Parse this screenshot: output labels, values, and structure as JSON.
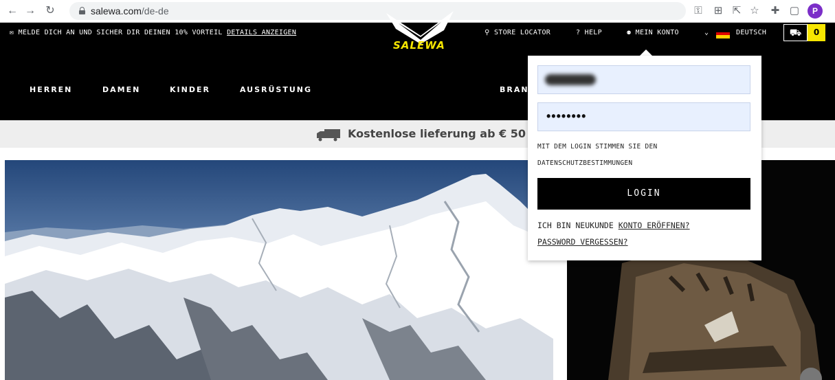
{
  "browser": {
    "back_icon": "arrow-left-icon",
    "forward_icon": "arrow-right-icon",
    "reload_icon": "reload-icon",
    "url_host": "salewa.com",
    "url_path": "/de-de",
    "profile_initial": "P"
  },
  "topbar": {
    "promo_text": "MELDE DICH AN UND SICHER DIR DEINEN 10% VORTEIL",
    "promo_link": "DETAILS ANZEIGEN",
    "store_locator": "STORE LOCATOR",
    "help": "HELP",
    "account": "MEIN KONTO",
    "language": "DEUTSCH",
    "cart_count": "0"
  },
  "nav": {
    "items": [
      "HERREN",
      "DAMEN",
      "KINDER",
      "AUSRÜSTUNG"
    ],
    "brand_partial": "BRAN",
    "logo_text": "SALEWA"
  },
  "banner": {
    "delivery_text": "Kostenlose lieferung ab € 50"
  },
  "login": {
    "password_mask": "••••••••",
    "consent_line1": "MIT DEM LOGIN STIMMEN SIE DEN",
    "consent_line2": "DATENSCHUTZBESTIMMUNGEN",
    "login_button": "LOGIN",
    "new_customer_text": "ICH BIN NEUKUNDE",
    "create_account_link": "KONTO ERÖFFNEN?",
    "forgot_password_link": "PASSWORD VERGESSEN?"
  },
  "colors": {
    "brand_yellow": "#f7e600",
    "header_black": "#000000",
    "autofill_blue": "#e8f0fe"
  }
}
